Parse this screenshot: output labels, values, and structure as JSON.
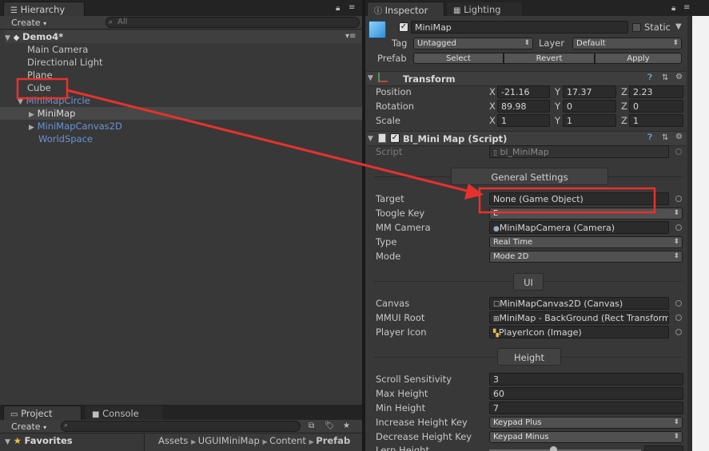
{
  "hierarchy": {
    "tab": "Hierarchy",
    "create": "Create",
    "search_placeholder": "All",
    "scene": "Demo4*",
    "items": [
      "Main Camera",
      "Directional Light",
      "Plane",
      "Cube",
      "MiniMapCircle",
      "MiniMap",
      "MiniMapCanvas2D",
      "WorldSpace"
    ]
  },
  "bottom": {
    "tab_project": "Project",
    "tab_console": "Console",
    "create": "Create",
    "favorites": "Favorites",
    "path": [
      "Assets",
      "UGUIMiniMap",
      "Content",
      "Prefab"
    ]
  },
  "inspector": {
    "tab": "Inspector",
    "tab_lighting": "Lighting",
    "object_name": "MiniMap",
    "static_label": "Static",
    "tag_label": "Tag",
    "tag_value": "Untagged",
    "layer_label": "Layer",
    "layer_value": "Default",
    "prefab_label": "Prefab",
    "prefab_select": "Select",
    "prefab_revert": "Revert",
    "prefab_apply": "Apply",
    "transform": {
      "title": "Transform",
      "position_label": "Position",
      "rotation_label": "Rotation",
      "scale_label": "Scale",
      "axis_x": "X",
      "axis_y": "Y",
      "axis_z": "Z",
      "position": [
        "-21.16",
        "17.37",
        "2.23"
      ],
      "rotation": [
        "89.98",
        "0",
        "0"
      ],
      "scale": [
        "1",
        "1",
        "1"
      ]
    },
    "script": {
      "title": "Bl_Mini Map (Script)",
      "script_label": "Script",
      "script_value": "bl_MiniMap",
      "general_settings": "General Settings",
      "target_label": "Target",
      "target_value": "None (Game Object)",
      "toogle_key_label": "Toogle Key",
      "toogle_key_value": "E",
      "mm_camera_label": "MM Camera",
      "mm_camera_value": "MiniMapCamera (Camera)",
      "type_label": "Type",
      "type_value": "Real Time",
      "mode_label": "Mode",
      "mode_value": "Mode 2D",
      "ui_section": "UI",
      "canvas_label": "Canvas",
      "canvas_value": "MiniMapCanvas2D (Canvas)",
      "mmui_root_label": "MMUI Root",
      "mmui_root_value": "MiniMap - BackGround (Rect Transform)",
      "player_icon_label": "Player Icon",
      "player_icon_value": "PlayerIcon (Image)",
      "height_section": "Height",
      "scroll_sensitivity_label": "Scroll Sensitivity",
      "scroll_sensitivity_value": "3",
      "max_height_label": "Max Height",
      "max_height_value": "60",
      "min_height_label": "Min Height",
      "min_height_value": "7",
      "increase_key_label": "Increase Height Key",
      "increase_key_value": "Keypad Plus",
      "decrease_key_label": "Decrease Height Key",
      "decrease_key_value": "Keypad Minus",
      "lerp_height_label": "Lerp Height"
    }
  },
  "annotation": {
    "color": "#e8312c"
  }
}
